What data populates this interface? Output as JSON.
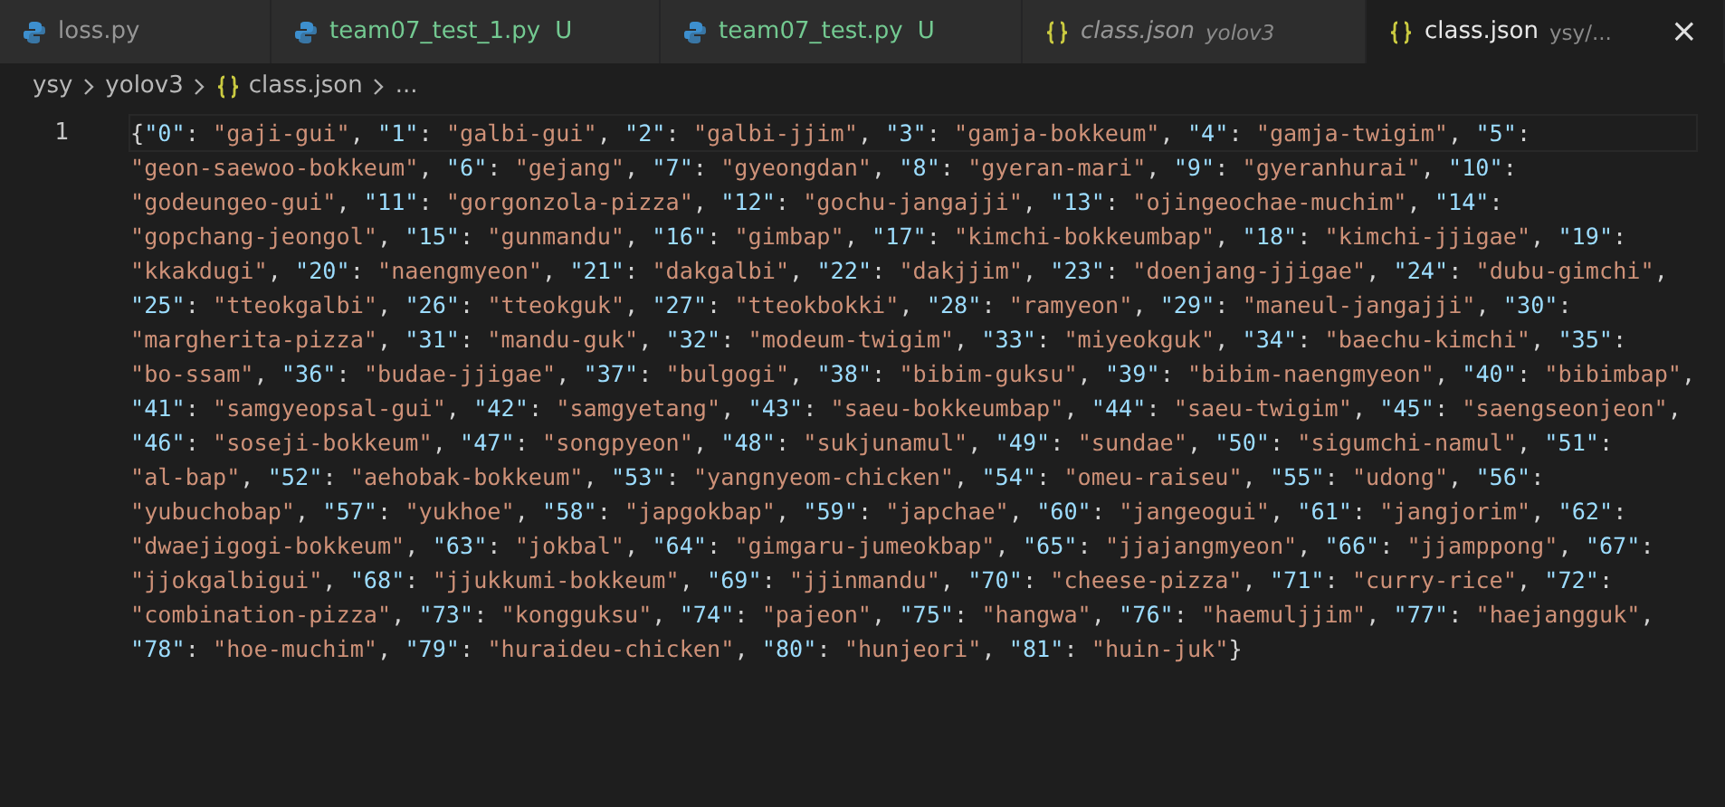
{
  "tabs": [
    {
      "label": "loss.py",
      "kind": "python",
      "selected": false,
      "preview": false
    },
    {
      "label": "team07_test_1.py",
      "kind": "python",
      "selected": false,
      "preview": false,
      "untracked": true,
      "badge": "U"
    },
    {
      "label": "team07_test.py",
      "kind": "python",
      "selected": false,
      "preview": false,
      "untracked": true,
      "badge": "U"
    },
    {
      "label": "class.json",
      "kind": "json",
      "selected": false,
      "preview": true,
      "description": "yolov3"
    },
    {
      "label": "class.json",
      "kind": "json",
      "selected": true,
      "preview": false,
      "description": "ysy/...",
      "close": "×"
    }
  ],
  "breadcrumbs": [
    {
      "label": "ysy"
    },
    {
      "label": "yolov3"
    },
    {
      "label": "class.json",
      "kind": "json"
    },
    {
      "label": "..."
    }
  ],
  "editor": {
    "line_number": "1",
    "wrapped_lines": [
      "{\"0\": \"gaji-gui\", \"1\": \"galbi-gui\", \"2\": \"galbi-jjim\", \"3\": \"gamja-bokkeum\", \"4\": \"gamja-twigim\", \"5\":",
      "\"geon-saewoo-bokkeum\", \"6\": \"gejang\", \"7\": \"gyeongdan\", \"8\": \"gyeran-mari\", \"9\": \"gyeranhurai\", \"10\":",
      "\"godeungeo-gui\", \"11\": \"gorgonzola-pizza\", \"12\": \"gochu-jangajji\", \"13\": \"ojingeochae-muchim\", \"14\":",
      "\"gopchang-jeongol\", \"15\": \"gunmandu\", \"16\": \"gimbap\", \"17\": \"kimchi-bokkeumbap\", \"18\": \"kimchi-jjigae\", \"19\":",
      "\"kkakdugi\", \"20\": \"naengmyeon\", \"21\": \"dakgalbi\", \"22\": \"dakjjim\", \"23\": \"doenjang-jjigae\", \"24\": \"dubu-gimchi\",",
      "\"25\": \"tteokgalbi\", \"26\": \"tteokguk\", \"27\": \"tteokbokki\", \"28\": \"ramyeon\", \"29\": \"maneul-jangajji\", \"30\":",
      "\"margherita-pizza\", \"31\": \"mandu-guk\", \"32\": \"modeum-twigim\", \"33\": \"miyeokguk\", \"34\": \"baechu-kimchi\", \"35\":",
      "\"bo-ssam\", \"36\": \"budae-jjigae\", \"37\": \"bulgogi\", \"38\": \"bibim-guksu\", \"39\": \"bibim-naengmyeon\", \"40\": \"bibimbap\",",
      "\"41\": \"samgyeopsal-gui\", \"42\": \"samgyetang\", \"43\": \"saeu-bokkeumbap\", \"44\": \"saeu-twigim\", \"45\": \"saengseonjeon\",",
      "\"46\": \"soseji-bokkeum\", \"47\": \"songpyeon\", \"48\": \"sukjunamul\", \"49\": \"sundae\", \"50\": \"sigumchi-namul\", \"51\":",
      "\"al-bap\", \"52\": \"aehobak-bokkeum\", \"53\": \"yangnyeom-chicken\", \"54\": \"omeu-raiseu\", \"55\": \"udong\", \"56\":",
      "\"yubuchobap\", \"57\": \"yukhoe\", \"58\": \"japgokbap\", \"59\": \"japchae\", \"60\": \"jangeogui\", \"61\": \"jangjorim\", \"62\":",
      "\"dwaejigogi-bokkeum\", \"63\": \"jokbal\", \"64\": \"gimgaru-jumeokbap\", \"65\": \"jjajangmyeon\", \"66\": \"jjamppong\", \"67\":",
      "\"jjokgalbigui\", \"68\": \"jjukkumi-bokkeum\", \"69\": \"jjinmandu\", \"70\": \"cheese-pizza\", \"71\": \"curry-rice\", \"72\":",
      "\"combination-pizza\", \"73\": \"kongguksu\", \"74\": \"pajeon\", \"75\": \"hangwa\", \"76\": \"haemuljjim\", \"77\": \"haejangguk\",",
      "\"78\": \"hoe-muchim\", \"79\": \"huraideu-chicken\", \"80\": \"hunjeori\", \"81\": \"huin-juk\"}"
    ]
  }
}
